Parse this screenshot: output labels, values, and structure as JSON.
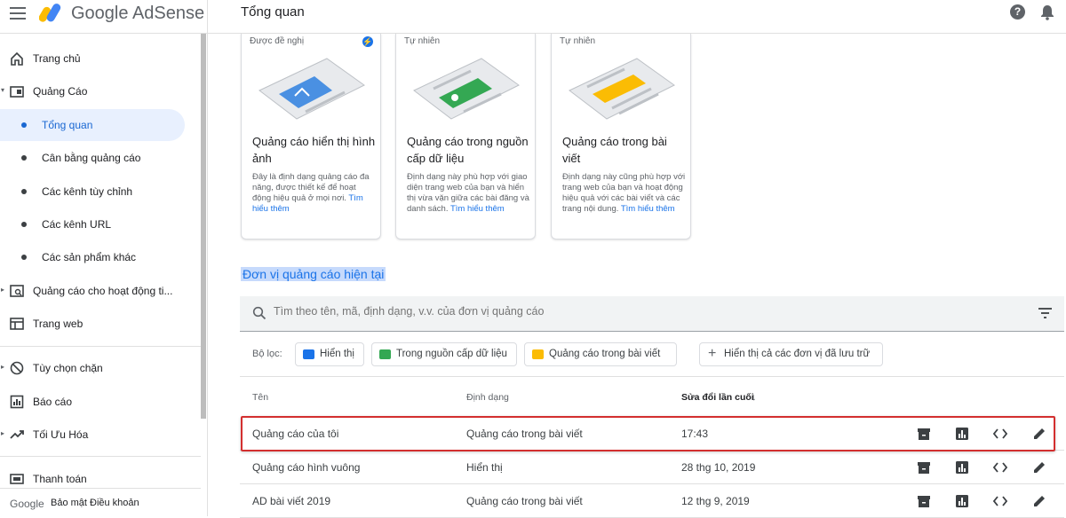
{
  "header": {
    "brand": "Google AdSense",
    "page_title": "Tổng quan"
  },
  "sidebar": {
    "items": [
      {
        "label": "Trang chủ"
      },
      {
        "label": "Quảng Cáo"
      },
      {
        "label": "Tổng quan"
      },
      {
        "label": "Cân bằng quảng cáo"
      },
      {
        "label": "Các kênh tùy chỉnh"
      },
      {
        "label": "Các kênh URL"
      },
      {
        "label": "Các sản phẩm khác"
      },
      {
        "label": "Quảng cáo cho hoạt động ti..."
      },
      {
        "label": "Trang web"
      },
      {
        "label": "Tùy chọn chặn"
      },
      {
        "label": "Báo cáo"
      },
      {
        "label": "Tối Ưu Hóa"
      },
      {
        "label": "Thanh toán"
      }
    ],
    "footer": {
      "google": "Google",
      "privacy": "Bảo mật",
      "terms": "Điều khoản"
    }
  },
  "cards": [
    {
      "tag": "Được đề nghị",
      "title": "Quảng cáo hiển thị hình ảnh",
      "desc": "Đây là định dạng quảng cáo đa năng, được thiết kế để hoạt động hiệu quả ở mọi nơi.",
      "link": "Tìm hiểu thêm",
      "color": "#4a90e2"
    },
    {
      "tag": "Tự nhiên",
      "title": "Quảng cáo trong nguồn cấp dữ liệu",
      "desc": "Định dạng này phù hợp với giao diện trang web của bạn và hiển thị vừa vặn giữa các bài đăng và danh sách.",
      "link": "Tìm hiểu thêm",
      "color": "#34a853"
    },
    {
      "tag": "Tự nhiên",
      "title": "Quảng cáo trong bài viết",
      "desc": "Định dạng này cũng phù hợp với trang web của bạn và hoạt động hiệu quả với các bài viết và các trang nội dung.",
      "link": "Tìm hiểu thêm",
      "color": "#fbbc04"
    }
  ],
  "ad_units": {
    "section_title": "Đơn vị quảng cáo hiện tại",
    "search_placeholder": "Tìm theo tên, mã, định dạng, v.v. của đơn vị quảng cáo",
    "filter_label": "Bộ lọc:",
    "chips": [
      {
        "label": "Hiển thị",
        "color": "#1a73e8"
      },
      {
        "label": "Trong nguồn cấp dữ liệu",
        "color": "#34a853"
      },
      {
        "label": "Quảng cáo trong bài viết",
        "color": "#fbbc04"
      }
    ],
    "archive_chip": "Hiển thị cả các đơn vị đã lưu trữ",
    "columns": [
      "Tên",
      "Định dạng",
      "Sửa đổi lần cuối"
    ],
    "rows": [
      {
        "name": "Quảng cáo của tôi",
        "format": "Quảng cáo trong bài viết",
        "modified": "17:43"
      },
      {
        "name": "Quảng cáo hình vuông",
        "format": "Hiển thị",
        "modified": "28 thg 10, 2019"
      },
      {
        "name": "AD bài viết 2019",
        "format": "Quảng cáo trong bài viết",
        "modified": "12 thg 9, 2019"
      }
    ]
  }
}
